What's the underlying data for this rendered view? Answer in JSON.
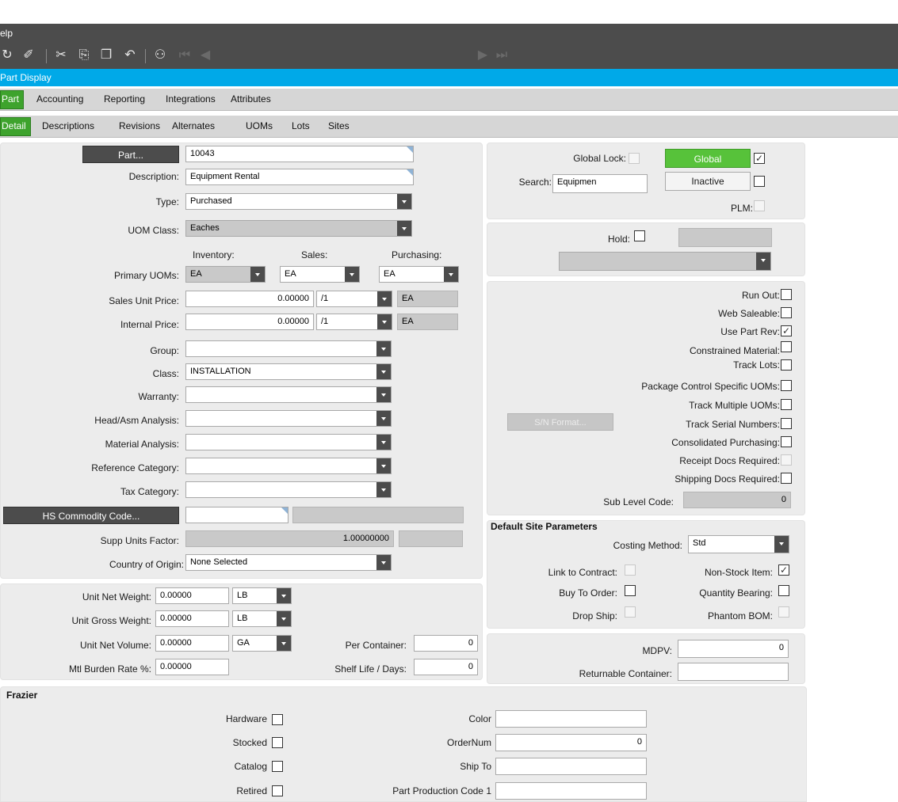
{
  "menu": {
    "help": "elp"
  },
  "toolbar": {
    "icons": [
      "refresh-icon",
      "clear-icon",
      "cut-icon",
      "copy-icon",
      "paste-icon",
      "undo-icon",
      "binoculars-icon",
      "first-record-icon",
      "previous-record-icon",
      "next-record-icon",
      "last-record-icon"
    ],
    "record_value": "10043"
  },
  "title": "Part Display",
  "tabs_primary": [
    "Part",
    "Accounting",
    "Reporting",
    "Integrations",
    "Attributes"
  ],
  "tabs_secondary": [
    "Detail",
    "Descriptions",
    "Revisions",
    "Alternates",
    "UOMs",
    "Lots",
    "Sites"
  ],
  "part": {
    "part_button": "Part...",
    "part_value": "10043",
    "description_label": "Description:",
    "description_value": "Equipment Rental",
    "type_label": "Type:",
    "type_value": "Purchased",
    "uom_class_label": "UOM Class:",
    "uom_class_value": "Eaches",
    "inventory_label": "Inventory:",
    "sales_label": "Sales:",
    "purchasing_label": "Purchasing:",
    "primary_uoms_label": "Primary UOMs:",
    "inventory_uom": "EA",
    "sales_uom": "EA",
    "purchasing_uom": "EA",
    "sales_price_label": "Sales Unit Price:",
    "sales_price_value": "0.00000",
    "sales_price_per": "/1",
    "sales_price_uom": "EA",
    "internal_price_label": "Internal Price:",
    "internal_price_value": "0.00000",
    "internal_price_per": "/1",
    "internal_price_uom": "EA",
    "group_label": "Group:",
    "group_value": "",
    "class_label": "Class:",
    "class_value": "INSTALLATION",
    "warranty_label": "Warranty:",
    "head_asm_label": "Head/Asm Analysis:",
    "material_analysis_label": "Material Analysis:",
    "reference_category_label": "Reference Category:",
    "tax_category_label": "Tax Category:",
    "hs_button": "HS Commodity Code...",
    "hs_value": "",
    "supp_units_label": "Supp Units Factor:",
    "supp_units_value": "1.00000000",
    "country_label": "Country of Origin:",
    "country_value": "None Selected"
  },
  "weights": {
    "net_weight_label": "Unit Net Weight:",
    "net_weight_value": "0.00000",
    "net_weight_uom": "LB",
    "gross_weight_label": "Unit Gross Weight:",
    "gross_weight_value": "0.00000",
    "gross_weight_uom": "LB",
    "net_volume_label": "Unit Net Volume:",
    "net_volume_value": "0.00000",
    "net_volume_uom": "GA",
    "burden_label": "Mtl Burden Rate %:",
    "burden_value": "0.00000",
    "per_container_label": "Per Container:",
    "per_container_value": "0",
    "shelf_life_label": "Shelf Life / Days:",
    "shelf_life_value": "0"
  },
  "global": {
    "global_lock_label": "Global Lock:",
    "global_button": "Global",
    "search_label": "Search:",
    "search_value": "Equipmen",
    "inactive_button": "Inactive",
    "plm_label": "PLM:"
  },
  "hold": {
    "hold_label": "Hold:",
    "hold_value": "",
    "reason_value": ""
  },
  "options": {
    "run_out": "Run Out:",
    "web_saleable": "Web Saleable:",
    "use_part_rev": "Use Part Rev:",
    "constrained_material": "Constrained Material:",
    "track_lots": "Track Lots:",
    "package_control": "Package Control Specific UOMs:",
    "track_multiple_uoms": "Track Multiple UOMs:",
    "sn_format_button": "S/N Format...",
    "track_serial": "Track Serial Numbers:",
    "consolidated_purchasing": "Consolidated Purchasing:",
    "receipt_docs": "Receipt Docs Required:",
    "shipping_docs": "Shipping Docs Required:",
    "sub_level_label": "Sub Level Code:",
    "sub_level_value": "0"
  },
  "site": {
    "heading": "Default Site Parameters",
    "costing_label": "Costing Method:",
    "costing_value": "Std",
    "link_contract": "Link to Contract:",
    "non_stock": "Non-Stock Item:",
    "buy_to_order": "Buy To Order:",
    "quantity_bearing": "Quantity Bearing:",
    "drop_ship": "Drop Ship:",
    "phantom_bom": "Phantom BOM:"
  },
  "mdpv": {
    "mdpv_label": "MDPV:",
    "mdpv_value": "0",
    "returnable_label": "Returnable Container:",
    "returnable_value": ""
  },
  "frazier": {
    "heading": "Frazier",
    "hardware": "Hardware",
    "stocked": "Stocked",
    "catalog": "Catalog",
    "retired": "Retired",
    "color_label": "Color",
    "color_value": "",
    "ordernum_label": "OrderNum",
    "ordernum_value": "0",
    "ship_to_label": "Ship To",
    "ship_to_value": "",
    "production_code_label": "Part Production Code 1",
    "production_code_value": ""
  }
}
